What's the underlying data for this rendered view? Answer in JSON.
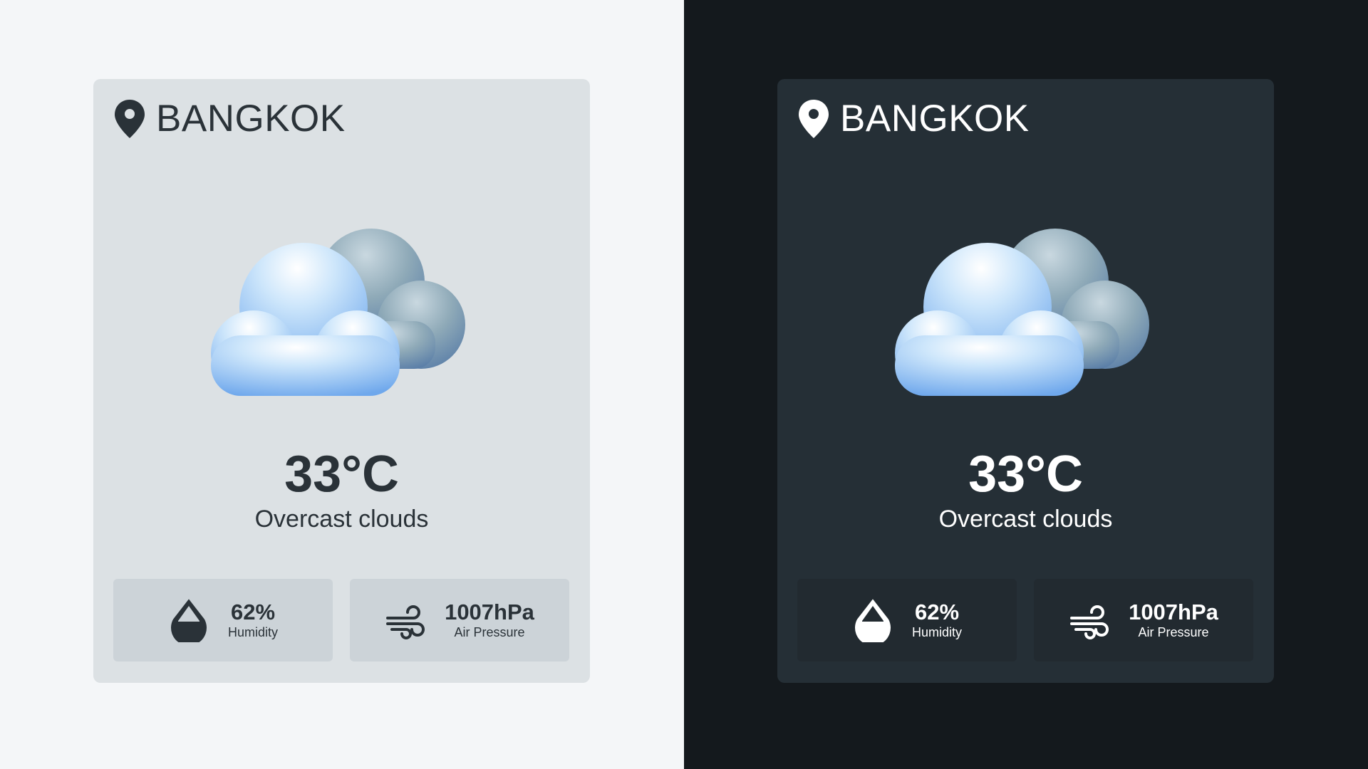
{
  "cards": [
    {
      "theme": "light",
      "location": {
        "icon": "location-pin-icon",
        "name": "BANGKOK"
      },
      "weather": {
        "icon": "overcast-clouds-icon",
        "temperature": "33°C",
        "description": "Overcast clouds"
      },
      "stats": {
        "humidity": {
          "icon": "water-drop-icon",
          "value": "62%",
          "label": "Humidity"
        },
        "pressure": {
          "icon": "wind-icon",
          "value": "1007hPa",
          "label": "Air Pressure"
        }
      }
    },
    {
      "theme": "dark",
      "location": {
        "icon": "location-pin-icon",
        "name": "BANGKOK"
      },
      "weather": {
        "icon": "overcast-clouds-icon",
        "temperature": "33°C",
        "description": "Overcast clouds"
      },
      "stats": {
        "humidity": {
          "icon": "water-drop-icon",
          "value": "62%",
          "label": "Humidity"
        },
        "pressure": {
          "icon": "wind-icon",
          "value": "1007hPa",
          "label": "Air Pressure"
        }
      }
    }
  ],
  "colors": {
    "light_page_bg": "#f4f6f8",
    "light_card_bg": "#dce1e4",
    "light_stat_bg": "#ccd3d8",
    "light_text": "#2a3238",
    "dark_page_bg": "#14191d",
    "dark_card_bg": "#252f36",
    "dark_stat_bg": "#222a30",
    "dark_text": "#ffffff"
  }
}
